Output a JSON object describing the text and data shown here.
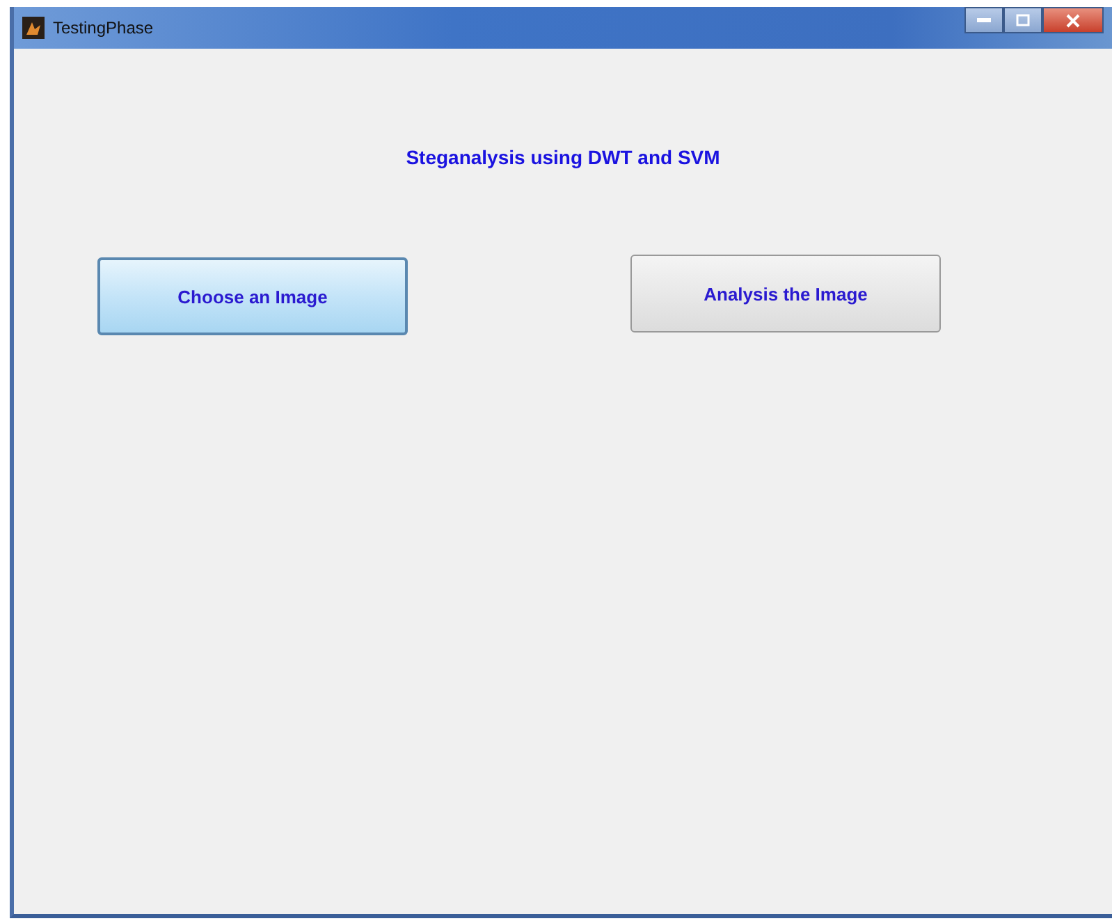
{
  "window": {
    "title": "TestingPhase"
  },
  "heading": "Steganalysis using DWT and SVM",
  "buttons": [
    {
      "label": "Choose an Image",
      "hovered": true
    },
    {
      "label": "Analysis the Image",
      "hovered": false
    }
  ]
}
